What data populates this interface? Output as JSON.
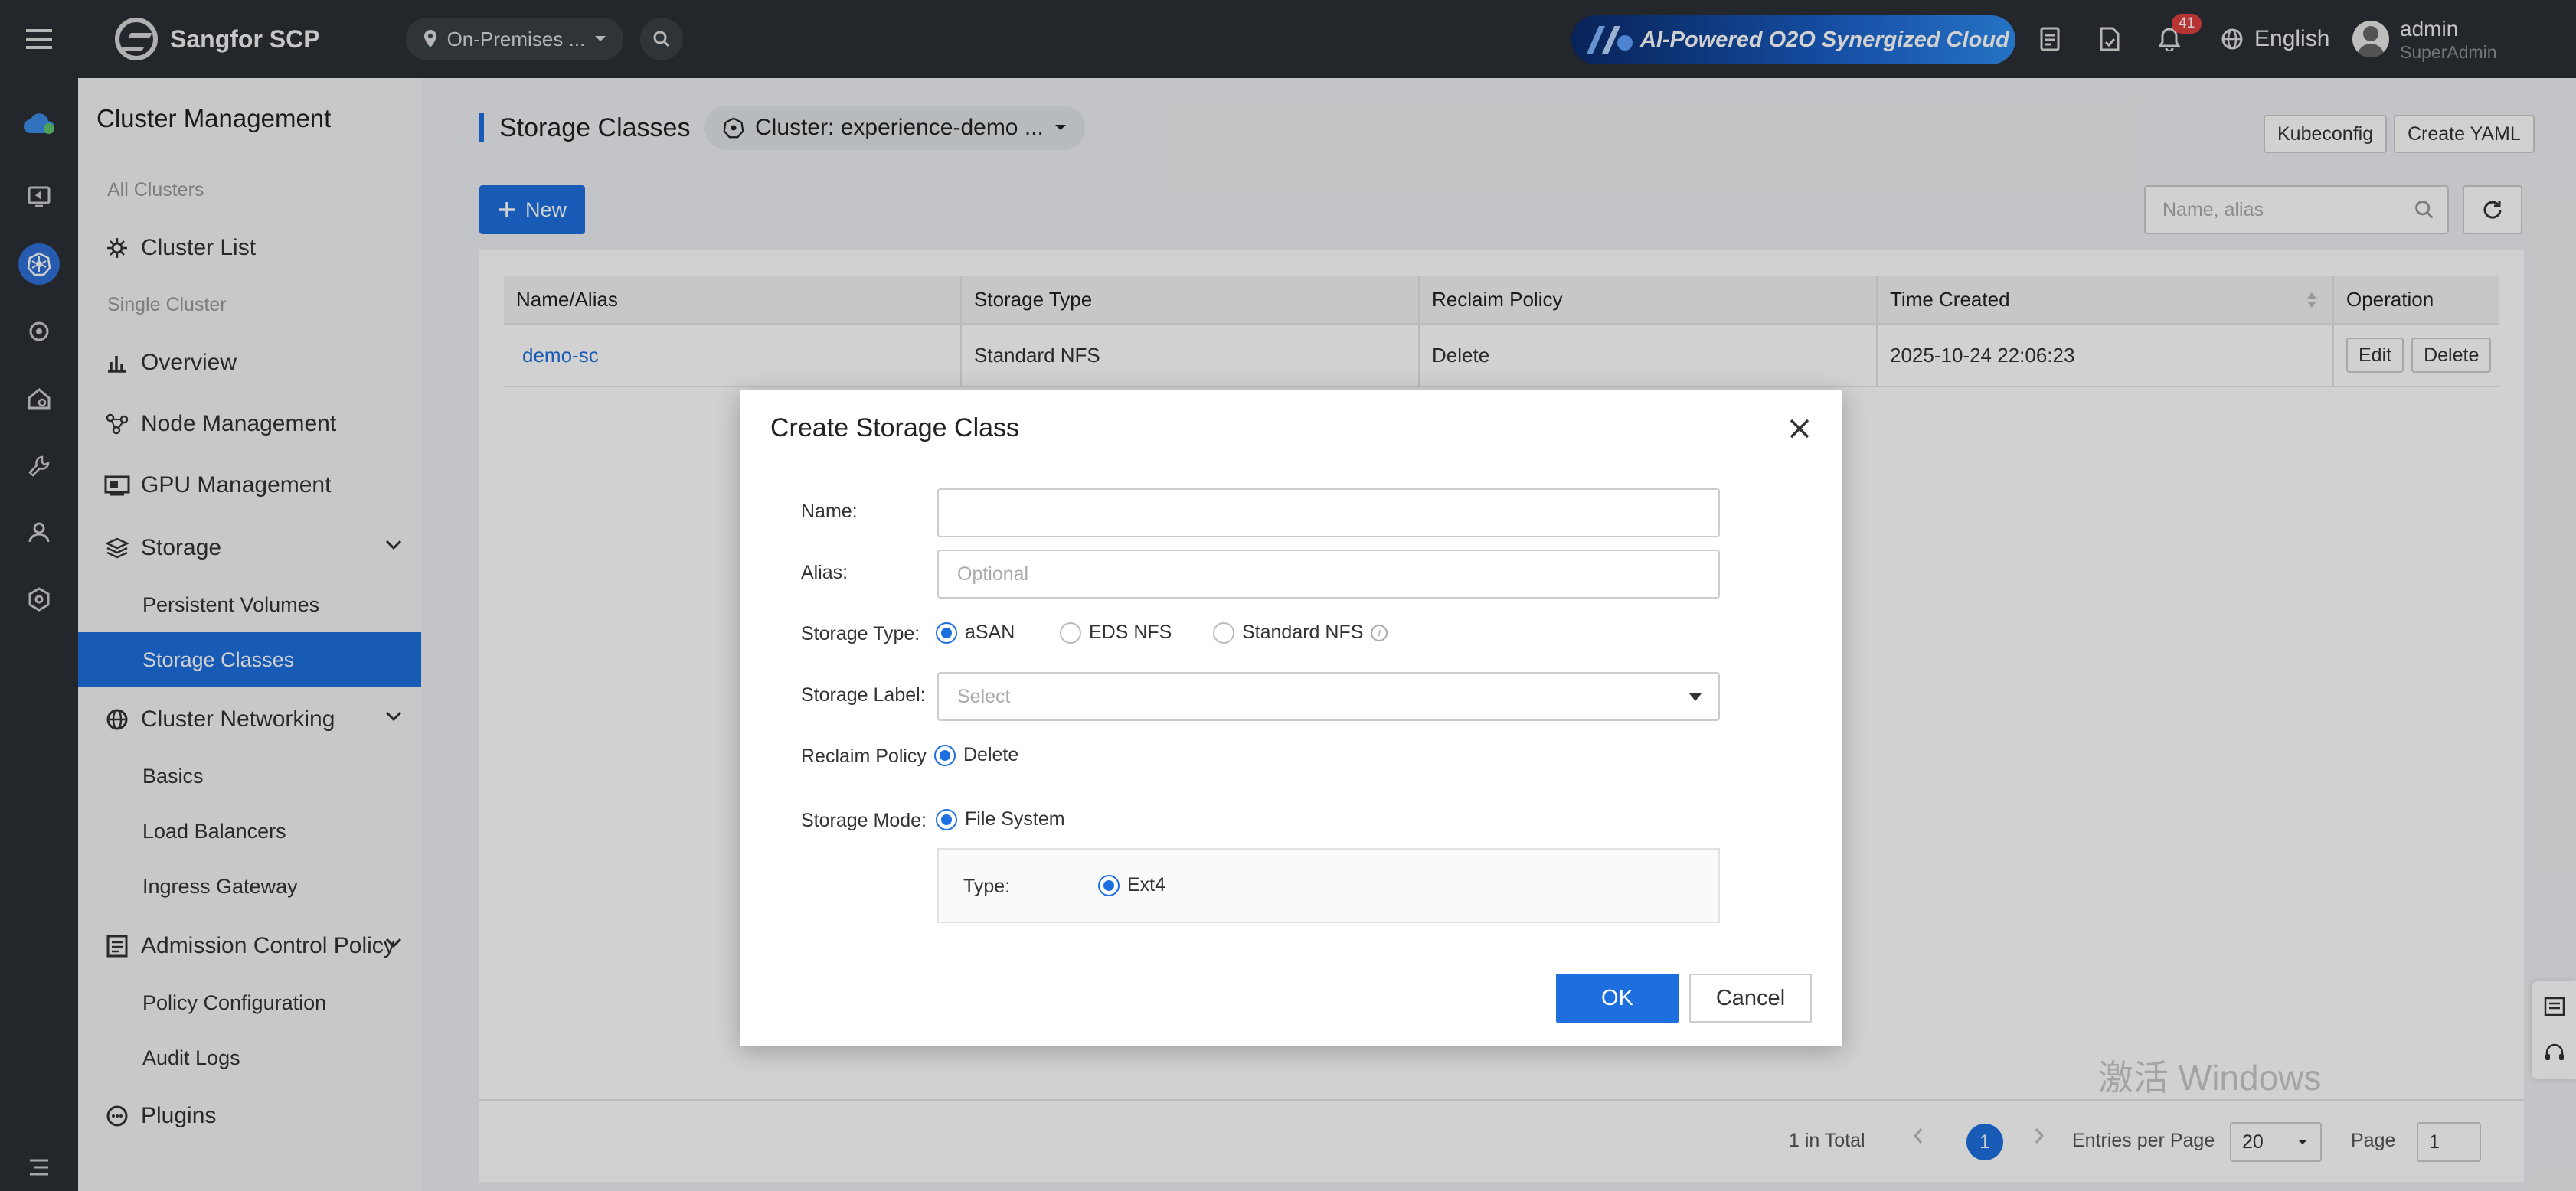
{
  "header": {
    "app_name": "Sangfor SCP",
    "environment": "On-Premises ...",
    "banner_text": "AI-Powered O2O Synergized Cloud",
    "notification_count": "41",
    "language": "English",
    "user_name": "admin",
    "user_role": "SuperAdmin"
  },
  "sidebar": {
    "title": "Cluster Management",
    "group_all": "All Clusters",
    "group_single": "Single Cluster",
    "items": {
      "cluster_list": "Cluster List",
      "overview": "Overview",
      "node_management": "Node Management",
      "gpu_management": "GPU Management",
      "storage": "Storage",
      "persistent_volumes": "Persistent Volumes",
      "storage_classes": "Storage Classes",
      "cluster_networking": "Cluster Networking",
      "basics": "Basics",
      "load_balancers": "Load Balancers",
      "ingress_gateway": "Ingress Gateway",
      "admission_control": "Admission Control Policy",
      "policy_configuration": "Policy Configuration",
      "audit_logs": "Audit Logs",
      "plugins": "Plugins"
    }
  },
  "main": {
    "page_title": "Storage Classes",
    "cluster_selector": "Cluster: experience-demo ...",
    "kubeconfig_label": "Kubeconfig",
    "create_yaml_label": "Create YAML",
    "new_label": "New",
    "search_placeholder": "Name, alias",
    "table": {
      "headers": [
        "Name/Alias",
        "Storage Type",
        "Reclaim Policy",
        "Time Created",
        "Operation"
      ],
      "rows": [
        {
          "name": "demo-sc",
          "storage_type": "Standard NFS",
          "reclaim_policy": "Delete",
          "time_created": "2025-10-24 22:06:23",
          "edit": "Edit",
          "delete": "Delete"
        }
      ]
    },
    "pagination": {
      "total": "1 in Total",
      "current_page": "1",
      "entries_label": "Entries per Page",
      "entries_value": "20",
      "page_label": "Page",
      "page_value": "1"
    }
  },
  "os_watermark": "激活 Windows",
  "modal": {
    "title": "Create Storage Class",
    "name_label": "Name:",
    "name_value": "",
    "alias_label": "Alias:",
    "alias_placeholder": "Optional",
    "storage_type_label": "Storage Type:",
    "storage_type_options": [
      "aSAN",
      "EDS NFS",
      "Standard NFS"
    ],
    "storage_type_selected": "aSAN",
    "storage_label_label": "Storage Label:",
    "storage_label_placeholder": "Select",
    "reclaim_policy_label": "Reclaim Policy",
    "reclaim_policy_option": "Delete",
    "storage_mode_label": "Storage Mode:",
    "storage_mode_option": "File System",
    "type_label": "Type:",
    "type_option": "Ext4",
    "ok_label": "OK",
    "cancel_label": "Cancel"
  },
  "colors": {
    "accent": "#1d6fe0",
    "topbar": "#2b3035",
    "badge": "#e04040"
  }
}
